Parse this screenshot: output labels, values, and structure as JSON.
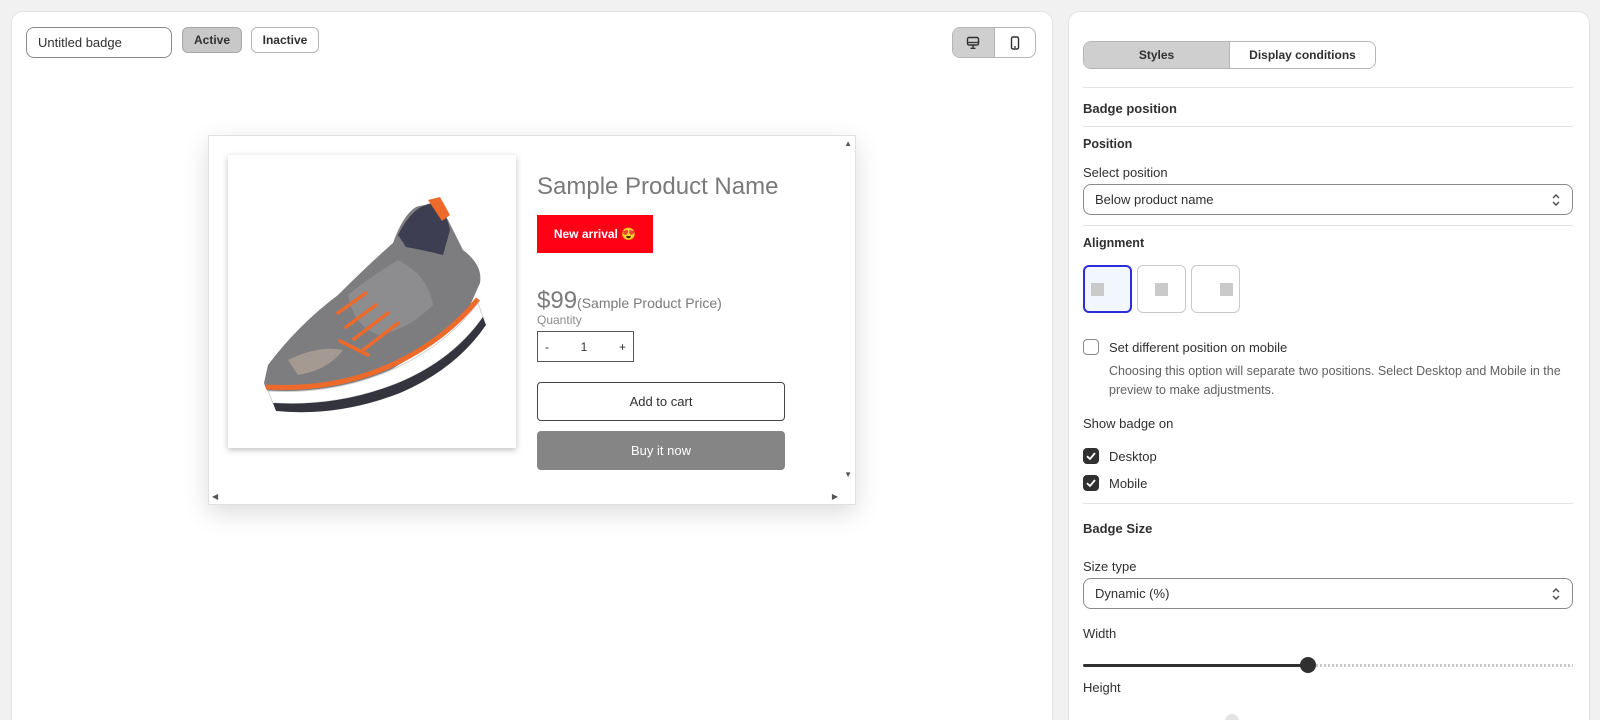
{
  "header": {
    "badge_name": "Untitled badge",
    "status_active_label": "Active",
    "status_inactive_label": "Inactive",
    "active_status": "Active",
    "preview_device": "desktop"
  },
  "preview": {
    "product_name": "Sample Product Name",
    "badge_text": "New arrival 😍",
    "badge_color": "#ff0015",
    "price": "$99",
    "price_label": "(Sample Product Price)",
    "quantity_label": "Quantity",
    "quantity_minus": "-",
    "quantity_value": "1",
    "quantity_plus": "+",
    "add_to_cart_label": "Add to cart",
    "buy_now_label": "Buy it now"
  },
  "settings": {
    "tabs": [
      {
        "label": "Styles",
        "active": true
      },
      {
        "label": "Display conditions",
        "active": false
      }
    ],
    "badge_position_heading": "Badge position",
    "position_heading": "Position",
    "select_position_label": "Select position",
    "select_position_value": "Below product name",
    "alignment_heading": "Alignment",
    "alignment_selected": "left",
    "mobile_position_label": "Set different position on mobile",
    "mobile_position_checked": false,
    "mobile_position_help": "Choosing this option will separate two positions. Select Desktop and Mobile in the preview to make adjustments.",
    "show_badge_on_label": "Show badge on",
    "show_desktop_label": "Desktop",
    "show_desktop_checked": true,
    "show_mobile_label": "Mobile",
    "show_mobile_checked": true,
    "badge_size_heading": "Badge Size",
    "size_type_label": "Size type",
    "size_type_value": "Dynamic (%)",
    "width_label": "Width",
    "width_value_fraction": 0.46,
    "height_label": "Height"
  },
  "colors": {
    "selection_accent": "#2d2dd8",
    "badge_red": "#ff0015"
  }
}
